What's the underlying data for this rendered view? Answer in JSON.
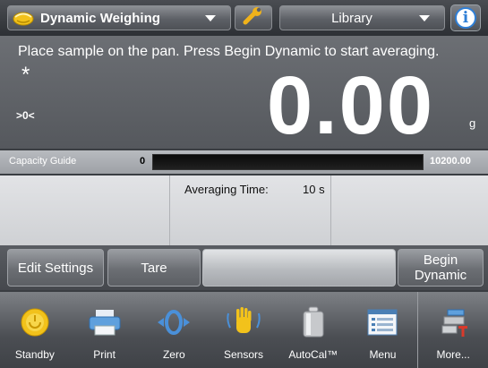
{
  "header": {
    "app_selector_label": "Dynamic Weighing",
    "library_label": "Library",
    "info_glyph": "i"
  },
  "display": {
    "prompt": "Place sample on the pan.  Press Begin Dynamic to start averaging.",
    "stable_indicator": "*",
    "zero_indicator": ">0<",
    "weight_value": "0.00",
    "unit": "g"
  },
  "capacity_guide": {
    "label": "Capacity Guide",
    "min": "0",
    "max": "10200.00",
    "fill_fraction": 0.0
  },
  "info_panel": {
    "averaging_time_label": "Averaging Time:",
    "averaging_time_value": "10 s"
  },
  "function_buttons": {
    "edit_settings": "Edit Settings",
    "tare": "Tare",
    "begin_dynamic_line1": "Begin",
    "begin_dynamic_line2": "Dynamic"
  },
  "nav": [
    {
      "label": "Standby",
      "icon": "standby-icon"
    },
    {
      "label": "Print",
      "icon": "printer-icon"
    },
    {
      "label": "Zero",
      "icon": "zero-icon"
    },
    {
      "label": "Sensors",
      "icon": "hand-sensor-icon"
    },
    {
      "label": "AutoCal™",
      "icon": "calibration-weight-icon"
    },
    {
      "label": "Menu",
      "icon": "menu-icon"
    },
    {
      "label": "More...",
      "icon": "more-icon"
    }
  ],
  "colors": {
    "accent_blue": "#2f7fd6",
    "icon_yellow": "#f2c21b",
    "capacity_bar": "#000000"
  }
}
